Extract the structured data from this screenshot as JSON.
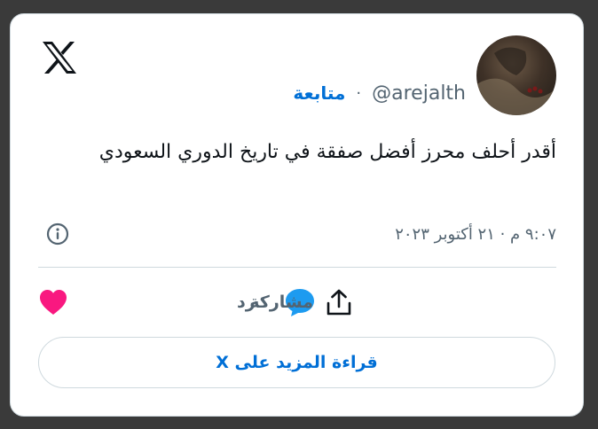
{
  "tweet": {
    "handle": "@arejalth",
    "separator": "·",
    "follow_label": "متابعة",
    "text": "أقدر أحلف محرز أفضل صفقة في تاريخ الدوري السعودي",
    "timestamp": "٩:٠٧ م · ٢١ أكتوبر ٢٠٢٣"
  },
  "actions": {
    "reply_label": "رد",
    "share_label": "مشاركة"
  },
  "read_more_label": "قراءة المزيد على X",
  "colors": {
    "accent": "#006fd6",
    "reply_bubble": "#1d9bf0",
    "like_heart": "#f91880",
    "secondary_text": "#536471",
    "border": "#cfd9de"
  },
  "icons": {
    "logo": "x-logo-icon",
    "info": "info-icon",
    "like": "heart-icon",
    "reply": "speech-bubble-icon",
    "share": "share-upload-icon"
  }
}
